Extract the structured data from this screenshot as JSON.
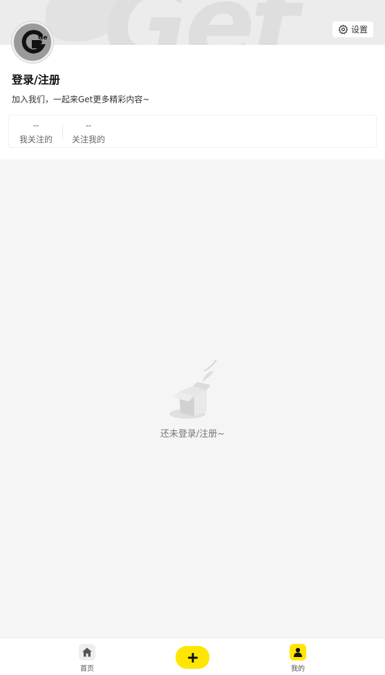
{
  "header": {
    "settings_label": "设置",
    "login_title": "登录/注册",
    "login_subtitle": "加入我们，一起来Get更多精彩内容~",
    "logo_text": "Get",
    "watermark_text": "Get"
  },
  "follow": {
    "items": [
      {
        "count": "--",
        "label": "我关注的"
      },
      {
        "count": "--",
        "label": "关注我的"
      }
    ]
  },
  "empty_state": {
    "text": "还未登录/注册~"
  },
  "bottom_nav": {
    "items": [
      {
        "label": "首页",
        "icon": "home-icon"
      },
      {
        "label": "",
        "icon": "plus-icon"
      },
      {
        "label": "我的",
        "icon": "user-icon"
      }
    ]
  },
  "colors": {
    "accent": "#ffe600",
    "background": "#f5f5f5",
    "card": "#ffffff"
  }
}
